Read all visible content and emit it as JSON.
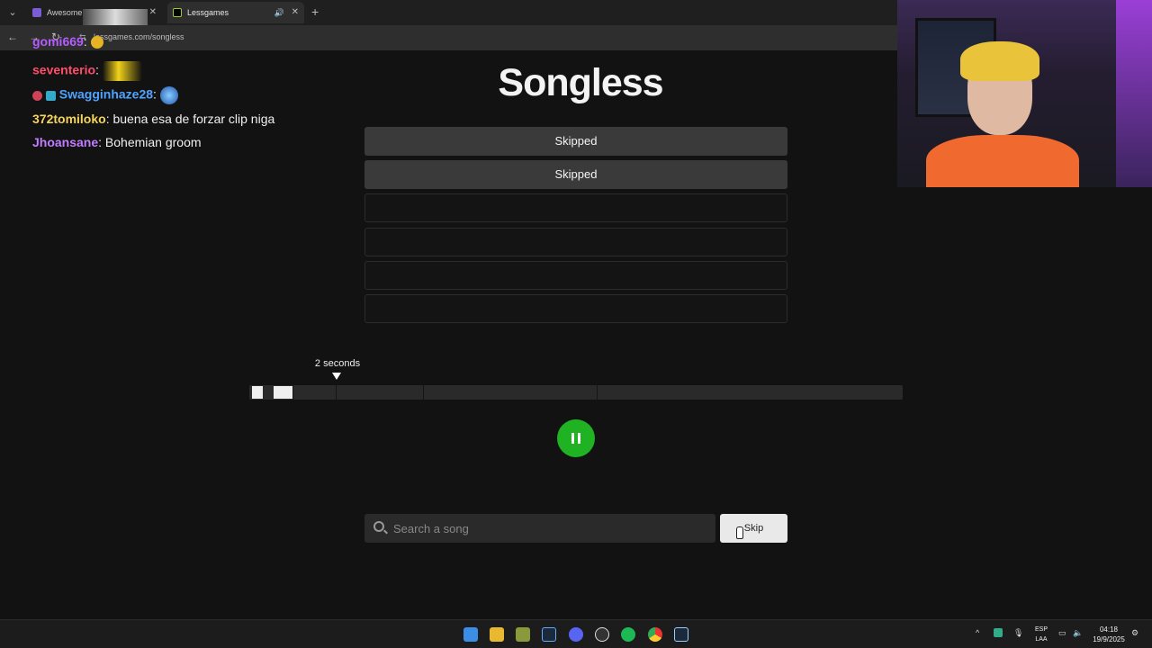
{
  "browser": {
    "tabs": [
      {
        "title": "Awesome N",
        "active": false
      },
      {
        "title": "Lessgames",
        "active": true
      }
    ],
    "url": "lessgames.com/songless"
  },
  "chat": [
    {
      "user": "gomi669",
      "user_color": "#b45cff",
      "message": ""
    },
    {
      "user": "seventerio",
      "user_color": "#ff4d6d",
      "message": ""
    },
    {
      "user": "Swagginhaze28",
      "user_color": "#4fa3ff",
      "message": ""
    },
    {
      "user": "372tomiloko",
      "user_color": "#f4d35e",
      "message": "buena esa de forzar clip niga"
    },
    {
      "user": "Jhoansane",
      "user_color": "#c07dff",
      "message": "Bohemian groom"
    }
  ],
  "game": {
    "title": "Songless",
    "guesses": [
      "Skipped",
      "Skipped",
      "",
      "",
      "",
      ""
    ],
    "seconds_label": "2 seconds",
    "search_placeholder": "Search a song",
    "skip_label": "Skip"
  },
  "taskbar": {
    "lang": [
      "ESP",
      "LAA"
    ],
    "time": "04:18",
    "date": "19/9/2025"
  },
  "colors": {
    "accent_green": "#1fb324",
    "background": "#121212"
  }
}
